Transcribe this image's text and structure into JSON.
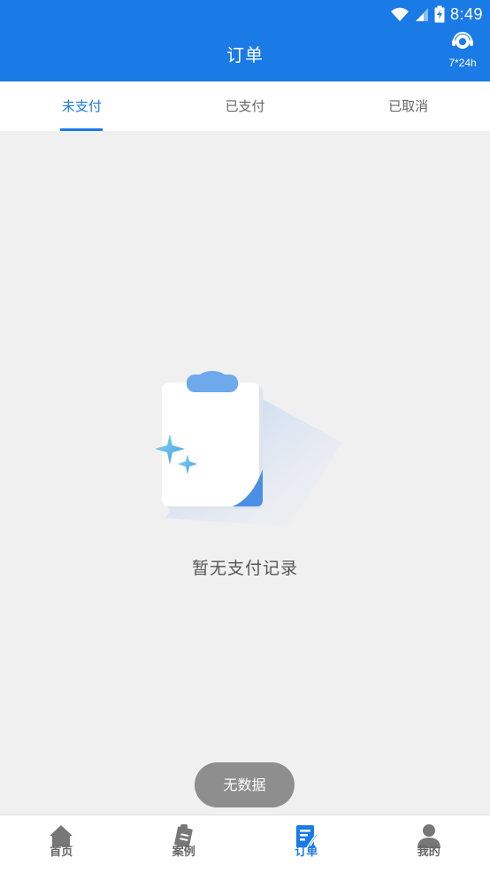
{
  "status_bar": {
    "time": "8:49"
  },
  "header": {
    "title": "订单",
    "support_label": "7*24h"
  },
  "tabs": [
    {
      "label": "未支付",
      "active": true
    },
    {
      "label": "已支付",
      "active": false
    },
    {
      "label": "已取消",
      "active": false
    }
  ],
  "empty_state": {
    "message": "暂无支付记录"
  },
  "toast": {
    "message": "无数据"
  },
  "bottom_nav": [
    {
      "label": "首页",
      "icon": "home-icon",
      "active": false
    },
    {
      "label": "案例",
      "icon": "case-icon",
      "active": false
    },
    {
      "label": "订单",
      "icon": "order-icon",
      "active": true
    },
    {
      "label": "我的",
      "icon": "profile-icon",
      "active": false
    }
  ],
  "colors": {
    "primary": "#1a7ae6",
    "background": "#f0f0f0",
    "toast": "#8e8e8e"
  }
}
